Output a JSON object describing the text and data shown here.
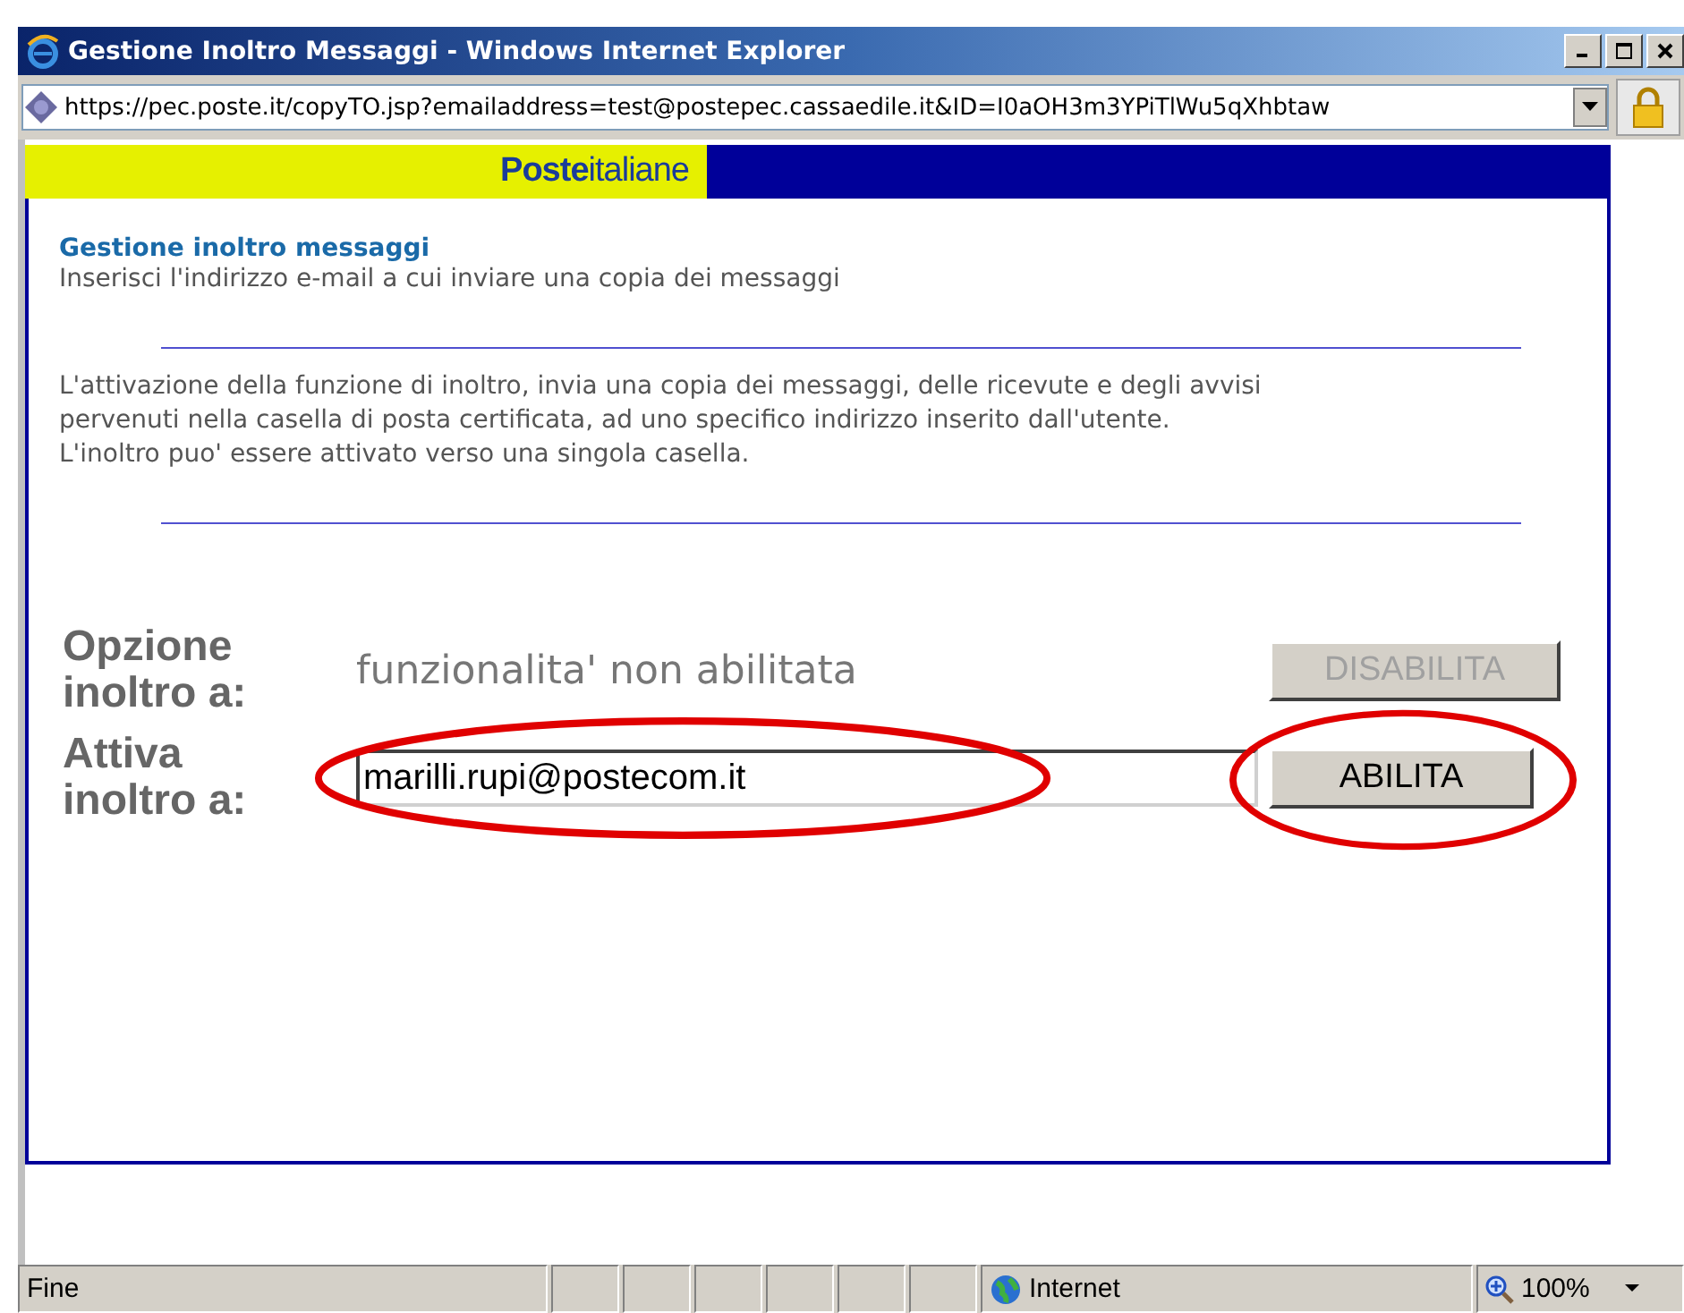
{
  "window": {
    "title": "Gestione Inoltro Messaggi - Windows Internet Explorer"
  },
  "address_bar": {
    "url": "https://pec.poste.it/copyTO.jsp?emailaddress=test@postepec.cassaedile.it&ID=I0aOH3m3YPiTlWu5qXhbtaw"
  },
  "banner": {
    "logo_bold": "Poste",
    "logo_light": "italiane"
  },
  "page": {
    "heading": "Gestione inoltro messaggi",
    "subtitle": "Inserisci l'indirizzo e-mail a cui inviare una copia dei messaggi",
    "description": [
      "L'attivazione della funzione di inoltro, invia una copia dei messaggi, delle ricevute e degli avvisi",
      "pervenuti nella casella di posta certificata, ad uno specifico indirizzo inserito dall'utente.",
      "L'inoltro puo' essere attivato verso una singola casella."
    ]
  },
  "form": {
    "rows": [
      {
        "kind": "status",
        "label": [
          "Opzione",
          "inoltro a:"
        ],
        "value": "funzionalita' non abilitata",
        "button": {
          "label": "DISABILITA",
          "disabled": true
        }
      },
      {
        "kind": "input",
        "label": [
          "Attiva",
          "inoltro a:"
        ],
        "value": "marilli.rupi@postecom.it",
        "highlighted": true,
        "button": {
          "label": "ABILITA",
          "disabled": false
        }
      }
    ]
  },
  "status_bar": {
    "status": "Fine",
    "zone": "Internet",
    "zoom": "100%"
  }
}
